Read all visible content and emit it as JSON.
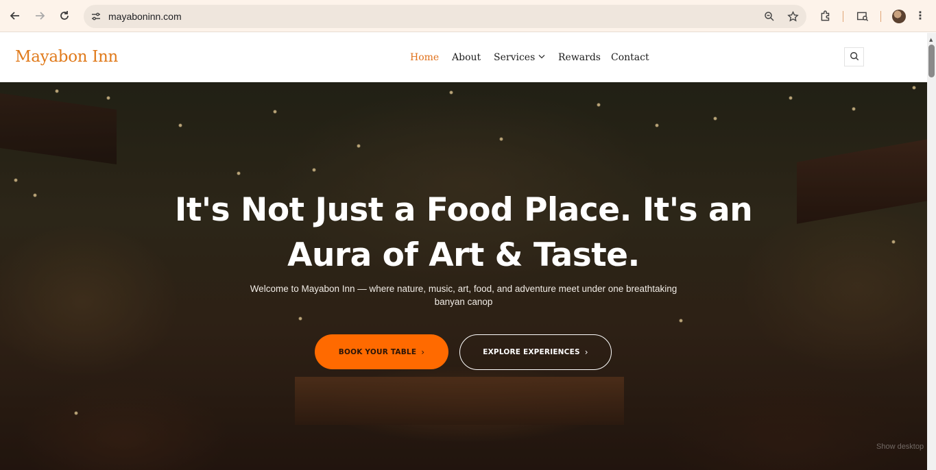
{
  "browser": {
    "url": "mayaboninn.com",
    "icons": {
      "back": "back-arrow-icon",
      "forward": "forward-arrow-icon",
      "reload": "reload-icon",
      "site_info": "tune-icon",
      "zoom": "zoom-icon",
      "bookmark": "star-icon",
      "extensions": "puzzle-icon",
      "media": "cast-search-icon",
      "profile": "avatar",
      "menu": "kebab-menu-icon"
    }
  },
  "site": {
    "logo": "Mayabon Inn",
    "nav": [
      {
        "label": "Home",
        "active": true
      },
      {
        "label": "About",
        "active": false
      },
      {
        "label": "Services",
        "active": false,
        "has_dropdown": true
      },
      {
        "label": "Rewards",
        "active": false
      },
      {
        "label": "Contact",
        "active": false
      }
    ],
    "search_icon": "search-icon",
    "accent_color": "#e07a1b",
    "button_color": "#ff6a00"
  },
  "hero": {
    "title_line1": "It's Not Just a Food Place. It's an",
    "title_line2": "Aura of Art & Taste.",
    "subtitle": "Welcome to Mayabon Inn — where nature, music, art, food, and adventure meet under one breathtaking banyan canop",
    "primary_button": "BOOK YOUR TABLE",
    "secondary_button": "EXPLORE EXPERIENCES",
    "arrow": "›"
  },
  "overlay_text": "Show desktop"
}
